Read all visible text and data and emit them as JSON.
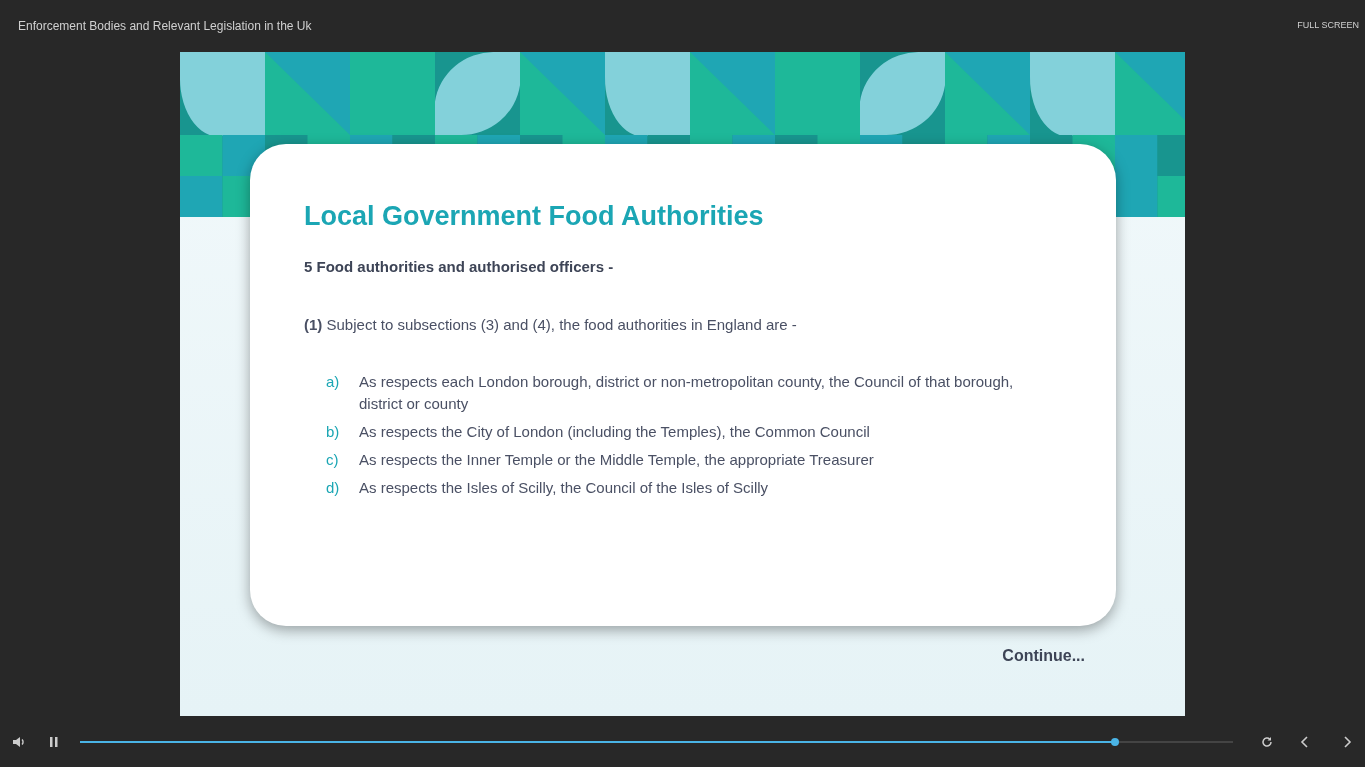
{
  "header": {
    "title": "Enforcement Bodies and Relevant Legislation in the Uk",
    "fullscreen": "FULL SCREEN"
  },
  "slide": {
    "heading": "Local Government Food Authorities",
    "subheading": "5 Food authorities and authorised officers -",
    "intro": "**(1)** Subject to subsections (3) and (4), the food authorities in England are -",
    "items": [
      {
        "marker": "a)",
        "text": "As respects each London borough, district or non-metropolitan county, the Council of that borough, district or county"
      },
      {
        "marker": "b)",
        "text": "As respects the City of London (including the Temples), the Common Council"
      },
      {
        "marker": "c)",
        "text": "As respects the Inner Temple or the Middle Temple, the appropriate Treasurer"
      },
      {
        "marker": "d)",
        "text": "As respects the Isles of Scilly, the Council of the Isles of Scilly"
      }
    ],
    "continue": "Continue..."
  },
  "player": {
    "playing": true,
    "progress": {
      "level": 0.898
    }
  }
}
